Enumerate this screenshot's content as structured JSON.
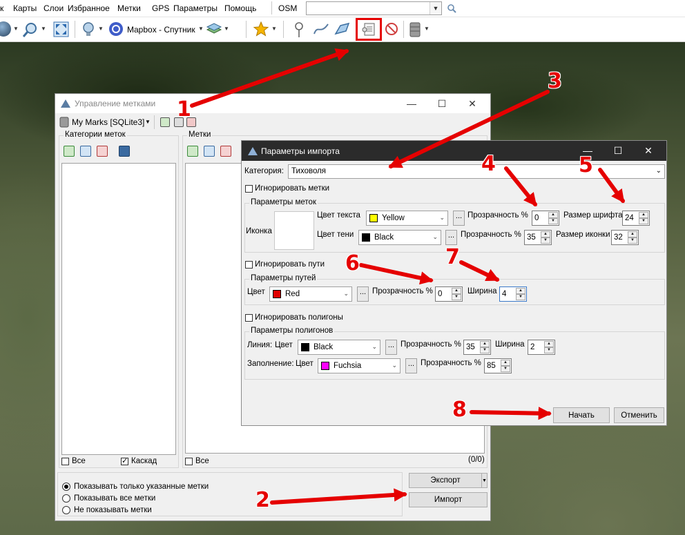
{
  "menu": [
    "к",
    "Карты",
    "Слои",
    "Избранное",
    "Метки",
    "GPS",
    "Параметры",
    "Помощь"
  ],
  "map_source": "OSM",
  "toolbar": {
    "layer_label": "Mapbox - Спутник"
  },
  "marks_window": {
    "title": "Управление метками",
    "db_label": "My Marks [SQLite3]",
    "categories_title": "Категории меток",
    "marks_title": "Метки",
    "cat_all": "Все",
    "cat_cascade": "Каскад",
    "marks_all": "Все",
    "marks_count": "(0/0)",
    "radio_show_selected": "Показывать только указанные метки",
    "radio_show_all": "Показывать все метки",
    "radio_hide": "Не показывать метки",
    "export_button": "Экспорт",
    "import_button": "Импорт"
  },
  "import_dialog": {
    "title": "Параметры импорта",
    "category_label": "Категория:",
    "category_value": "Тиховоля",
    "ignore_marks": "Игнорировать метки",
    "mark_params_title": "Параметры меток",
    "icon_label": "Иконка",
    "text_color_label": "Цвет текста",
    "text_color": {
      "name": "Yellow",
      "hex": "#ffff00"
    },
    "text_opacity_label": "Прозрачность %",
    "text_opacity": "0",
    "font_size_label": "Размер шрифта",
    "font_size": "24",
    "shadow_color_label": "Цвет тени",
    "shadow_color": {
      "name": "Black",
      "hex": "#000000"
    },
    "shadow_opacity_label": "Прозрачность %",
    "shadow_opacity": "35",
    "icon_size_label": "Размер иконки",
    "icon_size": "32",
    "ignore_paths": "Игнорировать пути",
    "path_params_title": "Параметры путей",
    "path_color_label": "Цвет",
    "path_color": {
      "name": "Red",
      "hex": "#e00000"
    },
    "path_opacity_label": "Прозрачность %",
    "path_opacity": "0",
    "path_width_label": "Ширина",
    "path_width": "4",
    "ignore_polygons": "Игнорировать полигоны",
    "polygon_params_title": "Параметры полигонов",
    "line_label": "Линия:",
    "line_color_label": "Цвет",
    "line_color": {
      "name": "Black",
      "hex": "#000000"
    },
    "line_opacity_label": "Прозрачность %",
    "line_opacity": "35",
    "line_width_label": "Ширина",
    "line_width": "2",
    "fill_label": "Заполнение:",
    "fill_color_label": "Цвет",
    "fill_color": {
      "name": "Fuchsia",
      "hex": "#ff00ff"
    },
    "fill_opacity_label": "Прозрачность %",
    "fill_opacity": "85",
    "start_button": "Начать",
    "cancel_button": "Отменить",
    "dots": "..."
  },
  "annotations": [
    "1",
    "2",
    "3",
    "4",
    "5",
    "6",
    "7",
    "8"
  ],
  "accent_color": "#e50000"
}
